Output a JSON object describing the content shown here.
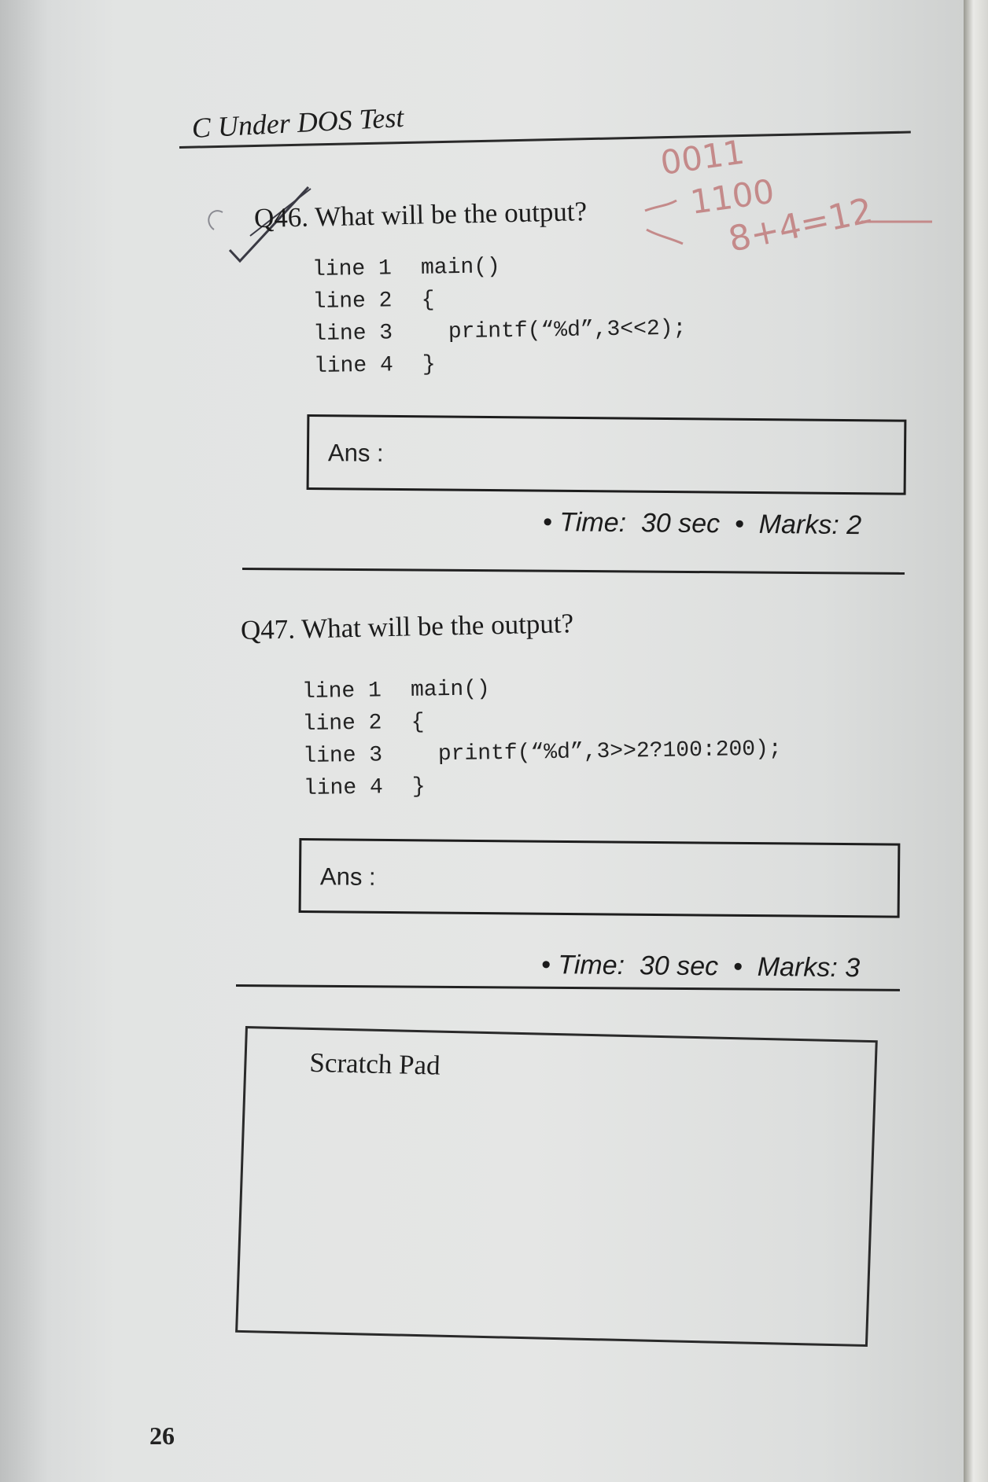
{
  "header": {
    "title": "C Under DOS Test"
  },
  "questions": [
    {
      "label": "Q46. What will be the output?",
      "code": [
        {
          "line": "line 1",
          "text": "main()"
        },
        {
          "line": "line 2",
          "text": "{"
        },
        {
          "line": "line 3",
          "text": "  printf(“%d”,3<<2);"
        },
        {
          "line": "line 4",
          "text": "}"
        }
      ],
      "answer_label": "Ans :",
      "meta": "• Time:  30 sec  •  Marks: 2"
    },
    {
      "label": "Q47. What will be the output?",
      "code": [
        {
          "line": "line 1",
          "text": "main()"
        },
        {
          "line": "line 2",
          "text": "{"
        },
        {
          "line": "line 3",
          "text": "  printf(“%d”,3>>2?100:200);"
        },
        {
          "line": "line 4",
          "text": "}"
        }
      ],
      "answer_label": "Ans :",
      "meta": "• Time:  30 sec  •  Marks: 3"
    }
  ],
  "scratch_pad": {
    "label": "Scratch Pad"
  },
  "page_number": "26",
  "handwriting": {
    "line1": "0011",
    "line2": "1100",
    "line3": "8+4=12",
    "color": "#c48a8a"
  }
}
